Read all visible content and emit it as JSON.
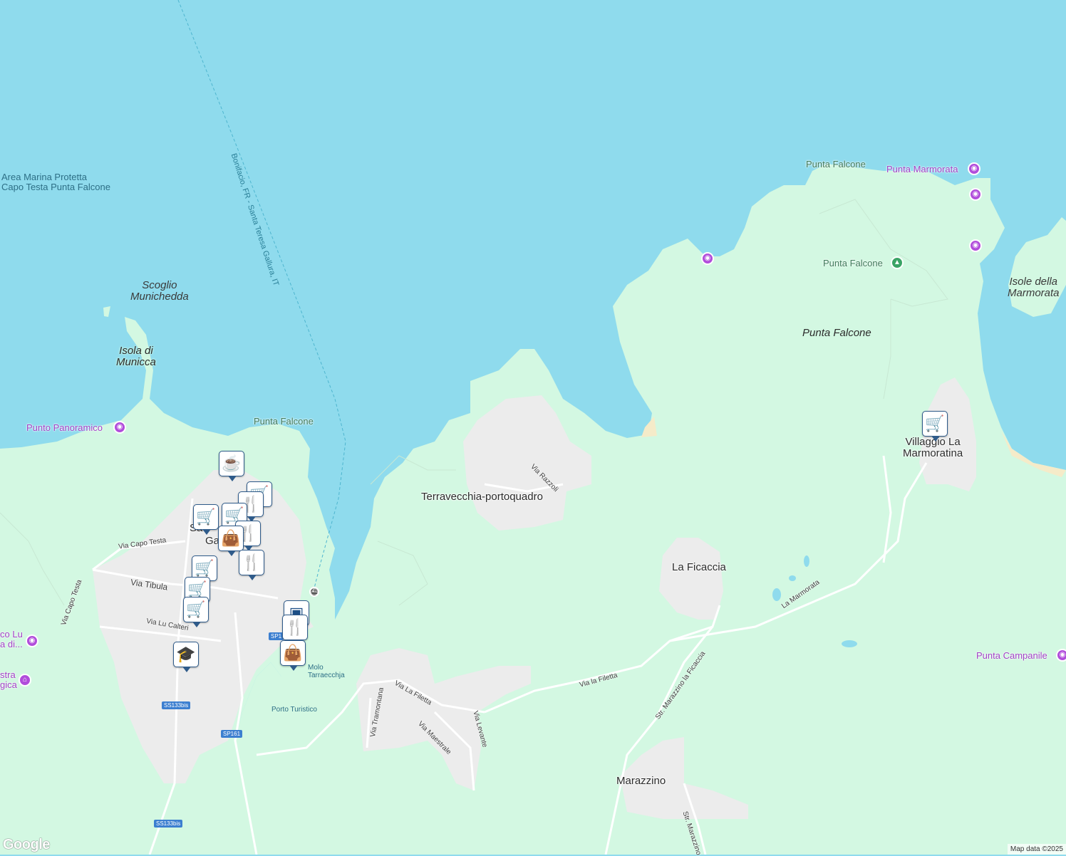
{
  "colors": {
    "sea": "#8fdbed",
    "land": "#d3f8e2",
    "urban": "#ececec",
    "road": "#ffffff",
    "poi_purple": "#a142c6",
    "marker_blue": "#1d4f86",
    "shield_blue": "#3c7fd0",
    "sand": "#f5ebc9"
  },
  "labels": {
    "marine_area": "Area Marina Protetta\nCapo Testa Punta Falcone",
    "ferry_route": "Bonifacio, FR - Santa Teresa Gallura, IT",
    "scoglio": "Scoglio\nMunichedda",
    "isola": "Isola di\nMunicca",
    "punto_panoramico": "Punto Panoramico",
    "punta_falcone_west": "Punta Falcone",
    "punta_falcone_north": "Punta Falcone",
    "punta_marmorata": "Punta Marmorata",
    "punta_falcone_park": "Punta Falcone",
    "isole_marmorata": "Isole della\nMarmorata",
    "punta_falcone_area": "Punta Falcone",
    "villaggio": "Villaggio La\nMarmoratina",
    "terravecchia": "Terravecchia-portoquadro",
    "la_ficaccia": "La Ficaccia",
    "marazzino": "Marazzino",
    "punta_campanile": "Punta Campanile",
    "molo": "Molo\nTarraecchja",
    "porto": "Porto Turistico",
    "town_partial": "Sa",
    "town_partial2": "Ga",
    "lu_partial": "co Lu\na di...",
    "astra_partial": "stra\ngica"
  },
  "roads": {
    "via_capo_testa_h": "Via Capo Testa",
    "via_capo_testa_v": "Via Capo Testa",
    "via_tibula": "Via Tibula",
    "via_lu_calteri": "Via Lu Calteri",
    "via_razzoli": "Via Razzoli",
    "la_marmorata": "La Marmorata",
    "via_la_filetta": "Via la Filetta",
    "str_marazzino_ficaccia": "Str. Marazzino la Ficaccia",
    "via_tramontana": "Via Tramontana",
    "via_la_filetta2": "Via La Filetta",
    "via_maestrale": "Via Maestrale",
    "via_levante": "Via Levante",
    "str_marazzino": "Str. Marazzino"
  },
  "shields": {
    "ss133bis_a": "SS133bis",
    "sp161": "SP161",
    "ss133bis_b": "SS133bis",
    "sp1": "SP1"
  },
  "markers": {
    "cafe": "cafe-icon",
    "shop_town_1": "shopping-cart-icon",
    "bag_1": "shopping-bag-icon",
    "restaurant_1": "restaurant-icon",
    "shop_town_2": "shopping-cart-icon",
    "shop_town_3": "shopping-cart-icon",
    "shop_town_4": "shopping-cart-icon",
    "school": "school-icon",
    "restaurant_2": "restaurant-icon",
    "bag_2": "shopping-bag-icon",
    "shop_villaggio": "shopping-cart-icon"
  },
  "footer": {
    "logo": "Google",
    "attribution": "Map data ©2025"
  }
}
